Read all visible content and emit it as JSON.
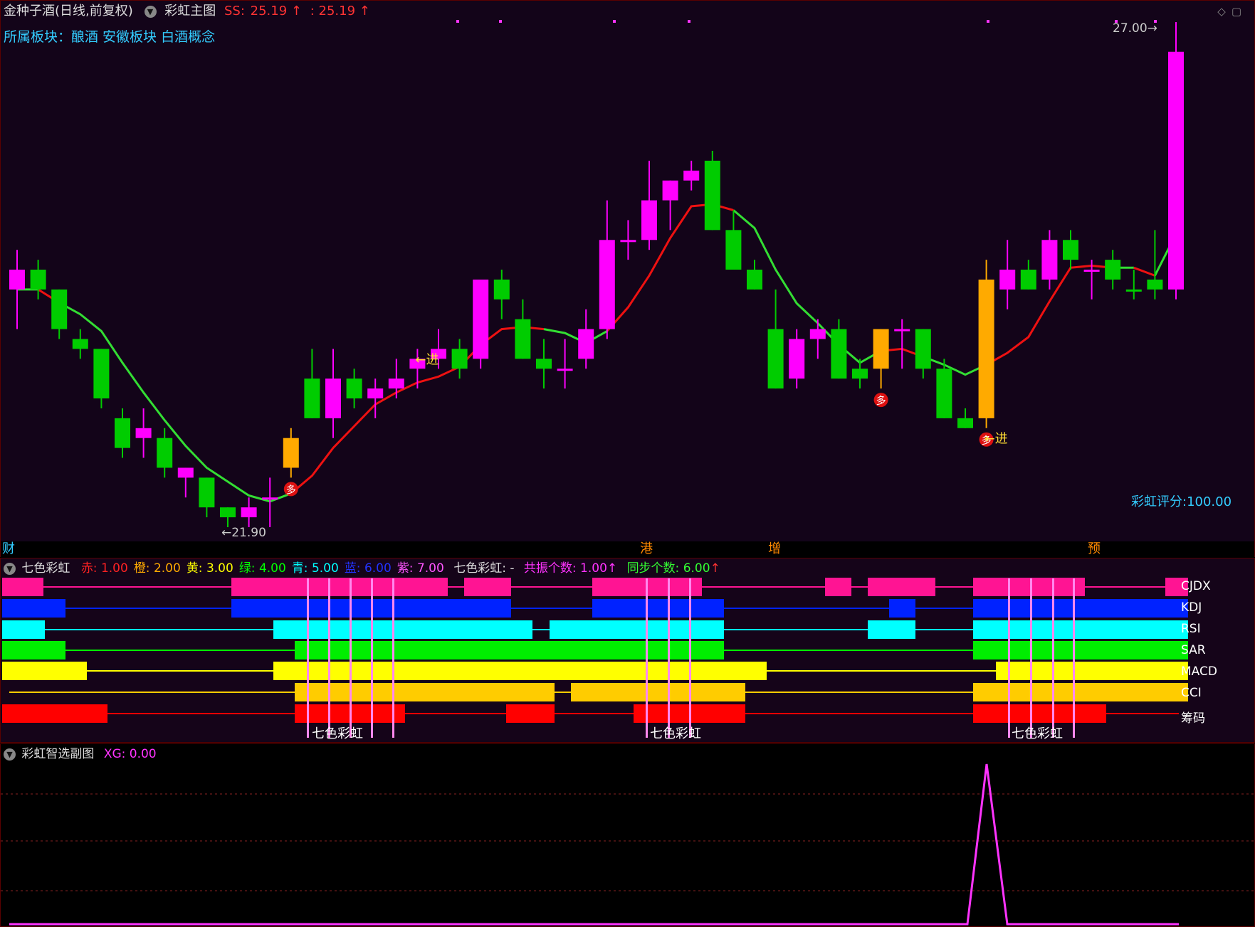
{
  "main": {
    "stock_name": "金种子酒(日线,前复权)",
    "indicator_name": "彩虹主图",
    "ss_label": "SS:",
    "ss_value": "25.19",
    "second_value": ": 25.19",
    "sector_label": "所属板块：",
    "sectors": "酿酒 安徽板块 白酒概念",
    "high_label": "27.00",
    "low_label": "21.90",
    "score_label": "彩虹评分:100.00",
    "enter_label": "进",
    "buy_label": "多",
    "axis_marks": [
      "财",
      "港",
      "增",
      "预"
    ],
    "colors": {
      "up": "#ff00ff",
      "down": "#00cc00",
      "signal": "#ffaa00",
      "ma_up": "#ee1111",
      "ma_down": "#33dd33"
    }
  },
  "indicator": {
    "title": "七色彩虹",
    "params": [
      {
        "k": "赤:",
        "v": "1.00",
        "color": "#ff2222"
      },
      {
        "k": "橙:",
        "v": "2.00",
        "color": "#ffaa00"
      },
      {
        "k": "黄:",
        "v": "3.00",
        "color": "#ffff00"
      },
      {
        "k": "绿:",
        "v": "4.00",
        "color": "#00ff00"
      },
      {
        "k": "青:",
        "v": "5.00",
        "color": "#00ffff"
      },
      {
        "k": "蓝:",
        "v": "6.00",
        "color": "#2233ff"
      },
      {
        "k": "紫:",
        "v": "7.00",
        "color": "#ff55ff"
      }
    ],
    "rainbow_label": "七色彩虹:",
    "rainbow_value": "-",
    "resonance_label": "共振个数:",
    "resonance_value": "1.00",
    "sync_label": "同步个数:",
    "sync_value": "6.00",
    "rows": [
      "CJDX",
      "KDJ",
      "RSI",
      "SAR",
      "MACD",
      "CCI",
      "筹码"
    ],
    "row_colors": [
      "#ff1493",
      "#0022ff",
      "#00ffff",
      "#00ee00",
      "#ffff00",
      "#ffcc00",
      "#ff0000"
    ],
    "marker_label": "七色彩虹"
  },
  "sub": {
    "title": "彩虹智选副图",
    "xg_label": "XG:",
    "xg_value": "0.00"
  },
  "chart_data": {
    "type": "candlestick",
    "xg_series": "single spike to 1 at the signal bar, 0 elsewhere",
    "price_range": [
      21.9,
      27.0
    ],
    "ohlc_note": "approximate daily candles read off chart",
    "candles": [
      {
        "o": 24.5,
        "h": 24.7,
        "l": 23.9,
        "c": 24.3,
        "t": "up"
      },
      {
        "o": 24.5,
        "h": 24.6,
        "l": 24.2,
        "c": 24.3,
        "t": "down"
      },
      {
        "o": 24.3,
        "h": 24.3,
        "l": 23.8,
        "c": 23.9,
        "t": "down"
      },
      {
        "o": 23.8,
        "h": 23.9,
        "l": 23.6,
        "c": 23.7,
        "t": "down"
      },
      {
        "o": 23.7,
        "h": 23.7,
        "l": 23.1,
        "c": 23.2,
        "t": "down"
      },
      {
        "o": 23.0,
        "h": 23.1,
        "l": 22.6,
        "c": 22.7,
        "t": "down"
      },
      {
        "o": 22.9,
        "h": 23.1,
        "l": 22.6,
        "c": 22.8,
        "t": "up"
      },
      {
        "o": 22.8,
        "h": 22.9,
        "l": 22.4,
        "c": 22.5,
        "t": "down"
      },
      {
        "o": 22.5,
        "h": 22.5,
        "l": 22.2,
        "c": 22.4,
        "t": "up"
      },
      {
        "o": 22.4,
        "h": 22.4,
        "l": 22.0,
        "c": 22.1,
        "t": "down"
      },
      {
        "o": 22.1,
        "h": 22.1,
        "l": 21.9,
        "c": 22.0,
        "t": "down"
      },
      {
        "o": 22.0,
        "h": 22.2,
        "l": 21.9,
        "c": 22.1,
        "t": "up"
      },
      {
        "o": 22.2,
        "h": 22.4,
        "l": 21.9,
        "c": 22.2,
        "t": "up"
      },
      {
        "o": 22.5,
        "h": 22.9,
        "l": 22.4,
        "c": 22.8,
        "t": "signal"
      },
      {
        "o": 23.4,
        "h": 23.7,
        "l": 23.0,
        "c": 23.0,
        "t": "down"
      },
      {
        "o": 23.0,
        "h": 23.7,
        "l": 22.8,
        "c": 23.4,
        "t": "up"
      },
      {
        "o": 23.4,
        "h": 23.5,
        "l": 23.1,
        "c": 23.2,
        "t": "down"
      },
      {
        "o": 23.2,
        "h": 23.4,
        "l": 23.0,
        "c": 23.3,
        "t": "up"
      },
      {
        "o": 23.3,
        "h": 23.6,
        "l": 23.2,
        "c": 23.4,
        "t": "up"
      },
      {
        "o": 23.6,
        "h": 23.7,
        "l": 23.3,
        "c": 23.5,
        "t": "up"
      },
      {
        "o": 23.6,
        "h": 23.9,
        "l": 23.5,
        "c": 23.7,
        "t": "up"
      },
      {
        "o": 23.5,
        "h": 23.8,
        "l": 23.4,
        "c": 23.7,
        "t": "down"
      },
      {
        "o": 23.6,
        "h": 24.4,
        "l": 23.5,
        "c": 24.4,
        "t": "up"
      },
      {
        "o": 24.4,
        "h": 24.5,
        "l": 24.0,
        "c": 24.2,
        "t": "down"
      },
      {
        "o": 24.0,
        "h": 24.2,
        "l": 23.6,
        "c": 23.6,
        "t": "down"
      },
      {
        "o": 23.5,
        "h": 23.8,
        "l": 23.3,
        "c": 23.6,
        "t": "down"
      },
      {
        "o": 23.5,
        "h": 23.8,
        "l": 23.3,
        "c": 23.5,
        "t": "up"
      },
      {
        "o": 23.6,
        "h": 24.1,
        "l": 23.5,
        "c": 23.9,
        "t": "up"
      },
      {
        "o": 23.9,
        "h": 25.2,
        "l": 23.8,
        "c": 24.8,
        "t": "up"
      },
      {
        "o": 24.8,
        "h": 25.0,
        "l": 24.6,
        "c": 24.8,
        "t": "up"
      },
      {
        "o": 24.8,
        "h": 25.6,
        "l": 24.7,
        "c": 25.2,
        "t": "up"
      },
      {
        "o": 25.2,
        "h": 25.4,
        "l": 24.9,
        "c": 25.4,
        "t": "up"
      },
      {
        "o": 25.4,
        "h": 25.6,
        "l": 25.3,
        "c": 25.5,
        "t": "up"
      },
      {
        "o": 25.6,
        "h": 25.7,
        "l": 24.9,
        "c": 24.9,
        "t": "down"
      },
      {
        "o": 24.9,
        "h": 25.1,
        "l": 24.5,
        "c": 24.5,
        "t": "down"
      },
      {
        "o": 24.5,
        "h": 24.6,
        "l": 24.3,
        "c": 24.3,
        "t": "down"
      },
      {
        "o": 23.9,
        "h": 24.3,
        "l": 23.3,
        "c": 23.3,
        "t": "down"
      },
      {
        "o": 23.4,
        "h": 23.9,
        "l": 23.3,
        "c": 23.8,
        "t": "up"
      },
      {
        "o": 23.8,
        "h": 24.0,
        "l": 23.6,
        "c": 23.9,
        "t": "up"
      },
      {
        "o": 23.9,
        "h": 24.0,
        "l": 23.4,
        "c": 23.4,
        "t": "down"
      },
      {
        "o": 23.5,
        "h": 23.6,
        "l": 23.3,
        "c": 23.4,
        "t": "down"
      },
      {
        "o": 23.5,
        "h": 23.9,
        "l": 23.3,
        "c": 23.9,
        "t": "signal"
      },
      {
        "o": 23.9,
        "h": 24.0,
        "l": 23.5,
        "c": 23.9,
        "t": "up"
      },
      {
        "o": 23.9,
        "h": 23.9,
        "l": 23.4,
        "c": 23.5,
        "t": "down"
      },
      {
        "o": 23.5,
        "h": 23.6,
        "l": 23.0,
        "c": 23.0,
        "t": "down"
      },
      {
        "o": 23.0,
        "h": 23.1,
        "l": 22.9,
        "c": 22.9,
        "t": "down"
      },
      {
        "o": 23.0,
        "h": 24.6,
        "l": 22.9,
        "c": 24.4,
        "t": "signal"
      },
      {
        "o": 24.3,
        "h": 24.8,
        "l": 24.1,
        "c": 24.5,
        "t": "up"
      },
      {
        "o": 24.5,
        "h": 24.6,
        "l": 24.3,
        "c": 24.3,
        "t": "down"
      },
      {
        "o": 24.4,
        "h": 24.9,
        "l": 24.3,
        "c": 24.8,
        "t": "up"
      },
      {
        "o": 24.8,
        "h": 24.9,
        "l": 24.5,
        "c": 24.6,
        "t": "down"
      },
      {
        "o": 24.5,
        "h": 24.6,
        "l": 24.2,
        "c": 24.5,
        "t": "up"
      },
      {
        "o": 24.6,
        "h": 24.7,
        "l": 24.3,
        "c": 24.4,
        "t": "down"
      },
      {
        "o": 24.3,
        "h": 24.5,
        "l": 24.2,
        "c": 24.3,
        "t": "down"
      },
      {
        "o": 24.3,
        "h": 24.9,
        "l": 24.2,
        "c": 24.4,
        "t": "down"
      },
      {
        "o": 24.3,
        "h": 27.0,
        "l": 24.2,
        "c": 26.7,
        "t": "up"
      }
    ]
  }
}
